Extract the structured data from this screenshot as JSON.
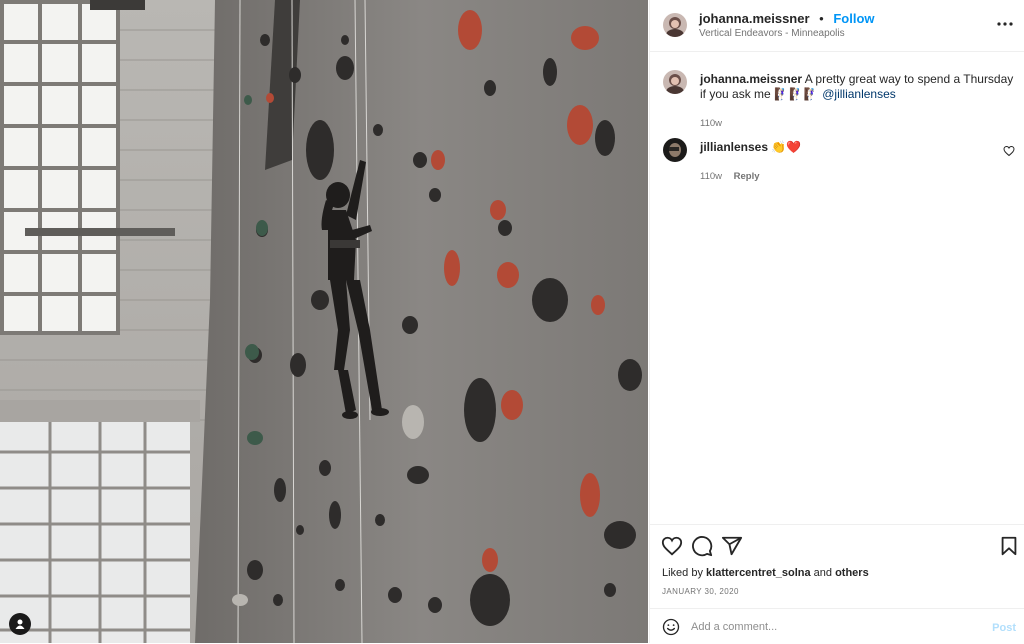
{
  "post": {
    "author": {
      "username": "johanna.meissner",
      "follow_label": "Follow",
      "separator": "•",
      "location": "Vertical Endeavors - Minneapolis"
    },
    "caption": {
      "username": "johanna.meissner",
      "text": "A pretty great way to spend a Thursday if you ask me",
      "emoji": "🧗🏻‍♀️🧗🏻‍♀️🧗🏻‍♀️",
      "mention": "@jillianlenses",
      "age": "110w"
    },
    "comments": [
      {
        "username": "jillianlenses",
        "text": "👏❤️",
        "age": "110w",
        "reply_label": "Reply"
      }
    ],
    "likes": {
      "prefix": "Liked by",
      "user": "klattercentret_solna",
      "conjunction": "and",
      "others": "others"
    },
    "date": "JANUARY 30, 2020",
    "comment_input": {
      "placeholder": "Add a comment...",
      "post_label": "Post"
    }
  },
  "icons": {
    "more": "more-options-icon",
    "like": "heart-icon",
    "comment": "comment-icon",
    "share": "share-icon",
    "save": "bookmark-icon",
    "emoji": "emoji-icon",
    "tagged": "user-tag-icon"
  },
  "colors": {
    "link": "#0095f6",
    "mention": "#00376b",
    "text": "#262626",
    "muted": "#737373",
    "post_disabled": "#b2dffc"
  }
}
